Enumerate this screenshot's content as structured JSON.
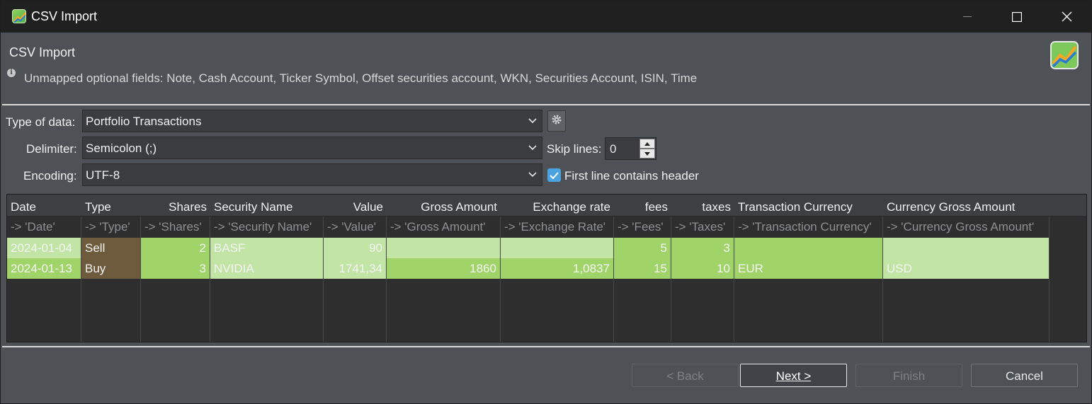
{
  "window": {
    "title": "CSV Import"
  },
  "header": {
    "title": "CSV Import",
    "info_message": "Unmapped optional fields: Note, Cash Account, Ticker Symbol, Offset securities account, WKN, Securities Account, ISIN, Time"
  },
  "settings": {
    "type_label": "Type of data:",
    "type_value": "Portfolio Transactions",
    "delimiter_label": "Delimiter:",
    "delimiter_value": "Semicolon (;)",
    "encoding_label": "Encoding:",
    "encoding_value": "UTF-8",
    "skip_lines_label": "Skip lines:",
    "skip_lines_value": "0",
    "header_checkbox_label": "First line contains header",
    "header_checkbox_checked": true
  },
  "table": {
    "columns": [
      {
        "header": "Date",
        "mapping": "-> 'Date'"
      },
      {
        "header": "Type",
        "mapping": "-> 'Type'"
      },
      {
        "header": "Shares",
        "mapping": "-> 'Shares'"
      },
      {
        "header": "Security Name",
        "mapping": "-> 'Security Name'"
      },
      {
        "header": "Value",
        "mapping": "-> 'Value'"
      },
      {
        "header": "Gross Amount",
        "mapping": "-> 'Gross Amount'"
      },
      {
        "header": "Exchange rate",
        "mapping": "-> 'Exchange Rate'"
      },
      {
        "header": "fees",
        "mapping": "-> 'Fees'"
      },
      {
        "header": "taxes",
        "mapping": "-> 'Taxes'"
      },
      {
        "header": "Transaction Currency",
        "mapping": "-> 'Transaction Currency'"
      },
      {
        "header": "Currency Gross Amount",
        "mapping": "-> 'Currency Gross Amount'"
      }
    ],
    "rows": [
      [
        "2024-01-04",
        "Sell",
        "2",
        "BASF",
        "90",
        "",
        "",
        "5",
        "3",
        "",
        ""
      ],
      [
        "2024-01-13",
        "Buy",
        "3",
        "NVIDIA",
        "1741,34",
        "1860",
        "1,0837",
        "15",
        "10",
        "EUR",
        "USD"
      ]
    ],
    "colors": {
      "mapped_light": "#c2e4a5",
      "mapped_dark": "#a0d469",
      "type_column": "#6e5a3c"
    }
  },
  "buttons": {
    "back": "< Back",
    "next": "Next >",
    "finish": "Finish",
    "cancel": "Cancel"
  }
}
